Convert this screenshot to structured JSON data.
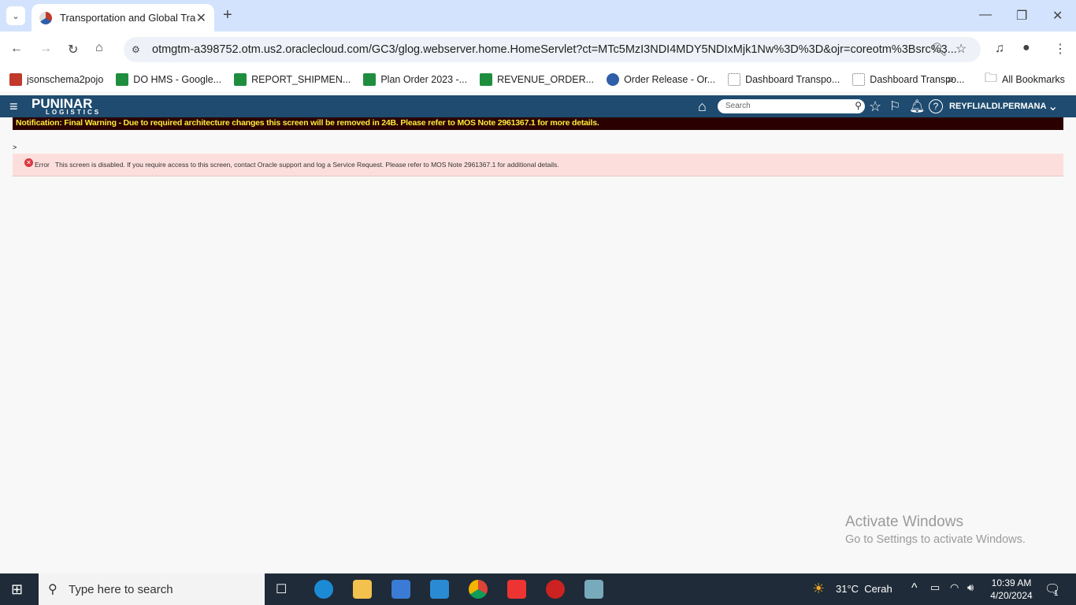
{
  "browser": {
    "tab_title": "Transportation and Global Trade",
    "new_tab": "+",
    "url": "otmgtm-a398752.otm.us2.oraclecloud.com/GC3/glog.webserver.home.HomeServlet?ct=MTc5MzI3NDI4MDY5NDIxMjk1Nw%3D%3D&ojr=coreotm%3Bsrc%3...",
    "bookmarks": [
      "jsonschema2pojo",
      "DO HMS - Google...",
      "REPORT_SHIPMEN...",
      "Plan Order 2023 -...",
      "REVENUE_ORDER...",
      "Order Release - Or...",
      "Dashboard Transpo...",
      "Dashboard Transpo..."
    ],
    "all_bookmarks": "All Bookmarks"
  },
  "app": {
    "logo": "PUNINAR",
    "logo_sub": "LOGISTICS",
    "search_placeholder": "Search",
    "user": "REYFLIALDI.PERMANA",
    "notification": "Notification: Final Warning - Due to required architecture changes this screen will be removed in 24B. Please refer to MOS Note 2961367.1 for more details.",
    "breadcrumb": ">",
    "error_label": "Error",
    "error_text": "This screen is disabled. If you require access to this screen, contact Oracle support and log a Service Request. Please refer to MOS Note 2961367.1 for additional details."
  },
  "watermark": {
    "title": "Activate Windows",
    "sub": "Go to Settings to activate Windows."
  },
  "taskbar": {
    "search": "Type here to search",
    "weather": "31°C  Cerah",
    "time": "10:39 AM",
    "date": "4/20/2024",
    "notif_count": "1"
  }
}
